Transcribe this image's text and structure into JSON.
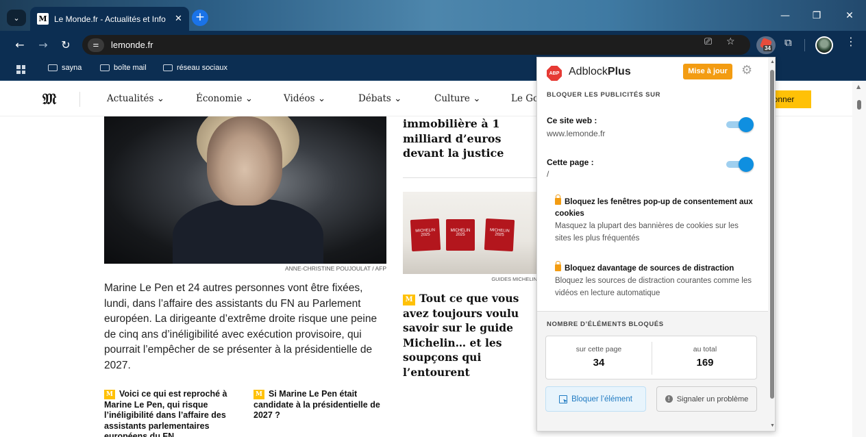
{
  "browser": {
    "tab_title": "Le Monde.fr - Actualités et Info",
    "tab_close": "✕",
    "new_tab": "+",
    "url": "lemonde.fr",
    "bookmarks": [
      "sayna",
      "boîte mail",
      "réseau sociaux"
    ],
    "ext_badge": "34"
  },
  "lemonde": {
    "logo": "𝔐",
    "nav": [
      "Actualités",
      "Économie",
      "Vidéos",
      "Débats",
      "Culture",
      "Le Go"
    ],
    "subscribe": "bonner",
    "hero_credit": "ANNE-CHRISTINE POUJOULAT / AFP",
    "hero_text": "Marine Le Pen et 24 autres personnes vont être fixées, lundi, dans l’affaire des assistants du FN au Parlement européen. La dirigeante d’extrême droite risque une peine de cinq ans d’inéligibilité avec exécution provisoire, qui pourrait l’empêcher de se présenter à la présidentielle de 2027.",
    "sub_article_1": "Voici ce qui est reproché à Marine Le Pen, qui risque l’inéligibilité dans l’affaire des assistants parlementaires européens du FN",
    "sub_article_2": "Si Marine Le Pen était candidate à la présidentielle de 2027 ?",
    "col2_headline": "immobilière à 1 milliard d’euros devant la justice",
    "michelin_credit": "GUIDES MICHELIN",
    "michelin_box_text": "MICHELIN 2025",
    "col2_article": "Tout ce que vous avez toujours voulu savoir sur le guide Michelin… et les soupçons qui l’entourent",
    "badge_letter": "M"
  },
  "adblock": {
    "brand_light": "Adblock",
    "brand_bold": "Plus",
    "logo_text": "ABP",
    "update_button": "Mise à jour",
    "block_heading": "BLOQUER LES PUBLICITÉS SUR",
    "site_label": "Ce site web :",
    "site_value": "www.lemonde.fr",
    "site_enabled": true,
    "page_label": "Cette page :",
    "page_value": "/",
    "page_enabled": true,
    "feature1_title": "Bloquez les fenêtres pop-up de consentement aux cookies",
    "feature1_desc": "Masquez la plupart des bannières de cookies sur les sites les plus fréquentés",
    "feature2_title": "Bloquez davantage de sources de distraction",
    "feature2_desc": "Bloquez les sources de distraction courantes comme les vidéos en lecture automatique",
    "blocked_heading": "NOMBRE D’ÉLÉMENTS BLOQUÉS",
    "stat_page_label": "sur cette page",
    "stat_page_value": "34",
    "stat_total_label": "au total",
    "stat_total_value": "169",
    "block_element_button": "Bloquer l’élément",
    "report_button": "Signaler un problème",
    "accent_color": "#0f8fe0"
  }
}
